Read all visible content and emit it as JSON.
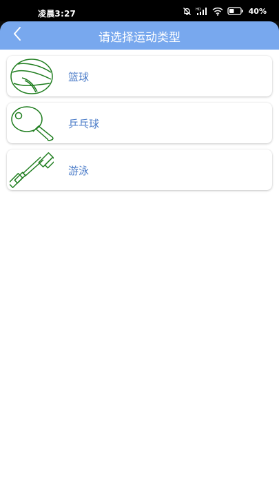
{
  "status_bar": {
    "time": "凌晨3:27",
    "network_badge": "HD",
    "battery": "40%",
    "icons": [
      "bell-muted-icon",
      "signal-icon",
      "wifi-icon",
      "battery-icon"
    ]
  },
  "header": {
    "title": "请选择运动类型",
    "back_icon": "chevron-left-icon",
    "background": "#78a8ee"
  },
  "sports": [
    {
      "label": "篮球",
      "icon": "basketball-icon"
    },
    {
      "label": "乒乓球",
      "icon": "ping-pong-paddle-icon"
    },
    {
      "label": "游泳",
      "icon": "dumbbell-icon"
    }
  ],
  "colors": {
    "icon_stroke": "#1e7d1e",
    "label_text": "#4a7bc8"
  }
}
